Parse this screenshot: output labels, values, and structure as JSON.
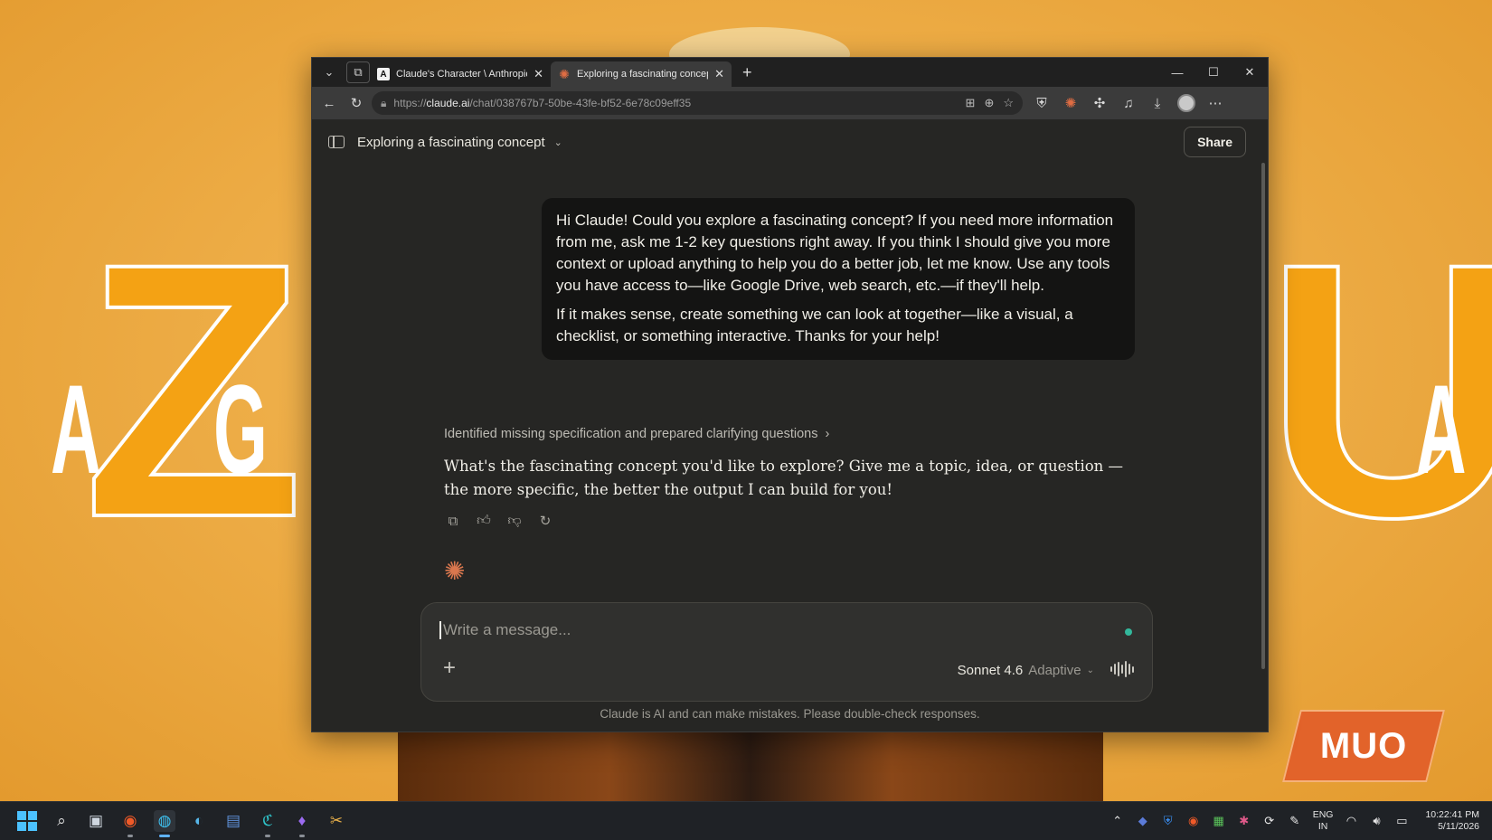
{
  "wallpaper": {
    "left_big": "Z",
    "left_small_1": "A",
    "left_small_2": "G",
    "right_big": "U",
    "right_small": "A",
    "watermark": "MUO"
  },
  "browser": {
    "tabs": [
      {
        "title": "Claude's Character \\ Anthropic",
        "favicon": "anthropic-logo-icon",
        "active": false
      },
      {
        "title": "Exploring a fascinating concept - C",
        "favicon": "claude-spark-icon",
        "active": true
      }
    ],
    "url": {
      "scheme": "https://",
      "host": "claude.ai",
      "path": "/chat/038767b7-50be-43fe-bf52-6e78c09eff35"
    }
  },
  "chat": {
    "title": "Exploring a fascinating concept",
    "share_label": "Share",
    "user_message": [
      "Hi Claude! Could you explore a fascinating concept? If you need more information from me, ask me 1-2 key questions right away. If you think I should give you more context or upload anything to help you do a better job, let me know. Use any tools you have access to—like Google Drive, web search, etc.—if they'll help.",
      "If it makes sense, create something we can look at together—like a visual, a checklist, or something interactive. Thanks for your help!"
    ],
    "thinking_summary": "Identified missing specification and prepared clarifying questions",
    "assistant_message": "What's the fascinating concept you'd like to explore? Give me a topic, idea, or question — the more specific, the better the output I can build for you!",
    "composer": {
      "placeholder": "Write a message...",
      "model_name": "Sonnet 4.6",
      "model_mode": "Adaptive"
    },
    "disclaimer": "Claude is AI and can make mistakes. Please double-check responses."
  },
  "taskbar": {
    "lang_1": "ENG",
    "lang_2": "IN",
    "time": "10:22:41 PM",
    "date": "5/11/2026"
  },
  "colors": {
    "accent": "#d9774e",
    "status_dot": "#33b89c",
    "page_bg": "#262624"
  }
}
